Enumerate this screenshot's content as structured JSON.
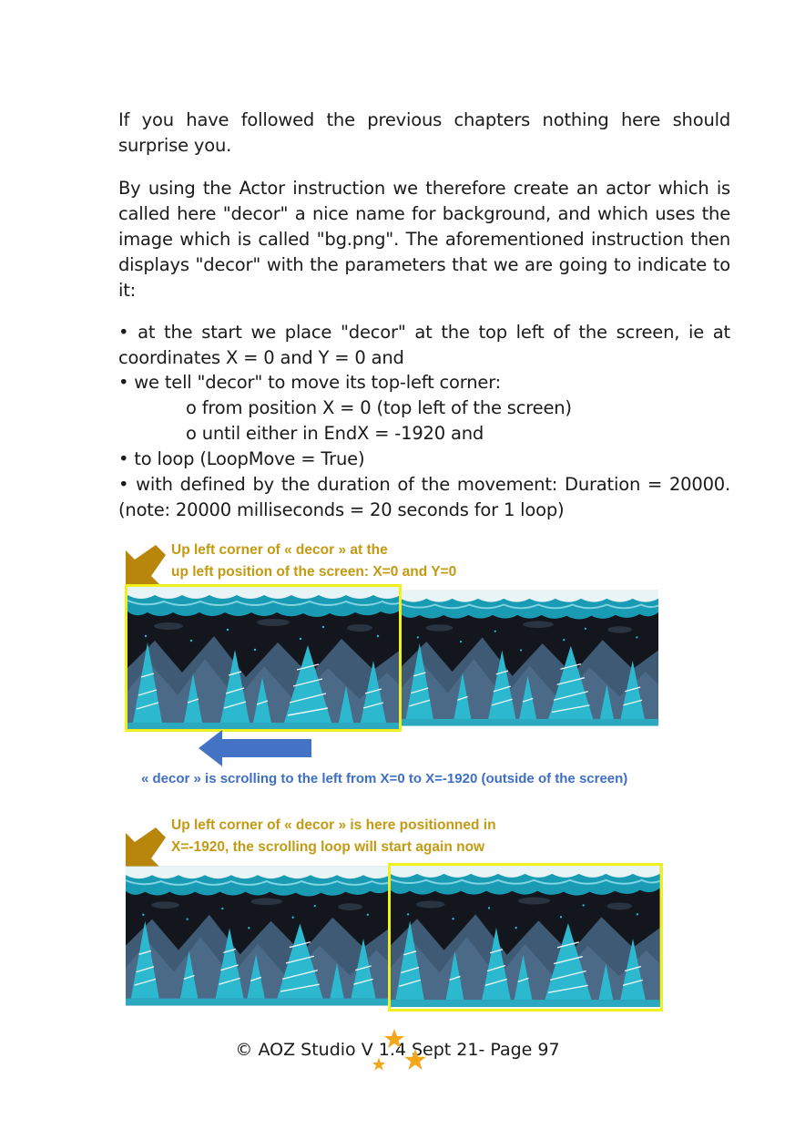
{
  "para1": "If you have followed the previous chapters nothing here should surprise you.",
  "para2": "By using the Actor instruction we therefore create an actor which is called here \"decor\" a nice name for background, and which uses the image which is called \"bg.png\". The aforementioned instruction then displays \"decor\" with the parameters that we are going to indicate to it:",
  "bullet1": "• at the start we place \"decor\" at the top left of the screen, ie at coordinates X = 0 and Y = 0 and",
  "bullet2": "• we tell \"decor\" to move its top-left corner:",
  "sub1": "o from position X = 0 (top left of the screen)",
  "sub2": "o until either in EndX = -1920 and",
  "bullet3": "• to loop (LoopMove = True)",
  "bullet4": "• with defined by the duration of the movement: Duration = 20000. (note: 20000 milliseconds = 20 seconds for 1 loop)",
  "figure1": {
    "caption_line1": "Up left corner of « decor » at the",
    "caption_line2": "up left position of the screen: X=0 and Y=0",
    "scroll_text": "« decor » is scrolling to the left from X=0 to X=-1920 (outside of the screen)"
  },
  "figure2": {
    "caption_line1": "Up left corner of « decor » is here positionned in",
    "caption_line2": "X=-1920, the scrolling loop will start again now"
  },
  "footer": "© AOZ Studio V 1.4 Sept 21- Page 97",
  "colors": {
    "caption_gold": "#c39a12",
    "arrow_gold": "#b8860b",
    "scroll_blue": "#3f6fc4",
    "arrow_blue": "#4472c4",
    "highlight_yellow": "#f2ef1f",
    "sky_dark": "#13161c",
    "cloud_teal": "#1a9bb4",
    "tree_cyan": "#2cb9d0",
    "mountain_slate": "#4a6a88"
  }
}
